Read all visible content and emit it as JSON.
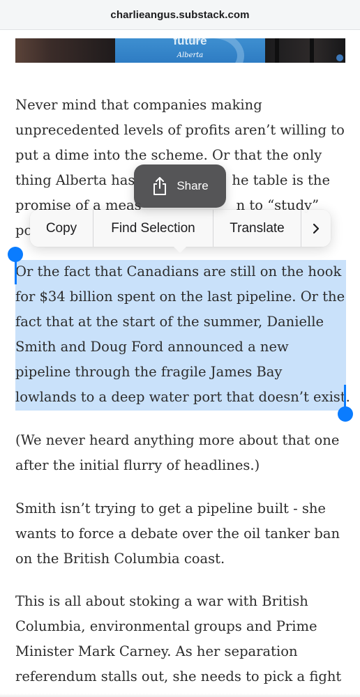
{
  "browser": {
    "url": "charlieangus.substack.com"
  },
  "hero_image": {
    "caption": "future",
    "brand": "Alberta"
  },
  "article": {
    "paragraph_1": [
      "Never mind that companies making",
      "unprecedented levels of profits aren’t willing to",
      "put a dime into the scheme. Or that the only",
      "thing Alberta has",
      "he table is the",
      "promise of a meas",
      "n to “study”",
      "pc"
    ],
    "paragraph_2": [
      "Or the fact that Canadians are still on the hook",
      "for $34 billion spent on the last pipeline. Or the",
      "fact that at the start of the summer, Danielle",
      "Smith and Doug Ford announced a new",
      "pipeline through the fragile James Bay",
      "lowlands to a deep water port that doesn’t exist."
    ],
    "paragraph_3": [
      "(We never heard anything more about that one",
      "after the initial flurry of headlines.)"
    ],
    "paragraph_4": [
      "Smith isn’t trying to get a pipeline built - she",
      "wants to force a debate over the oil tanker ban",
      "on the British Columbia coast."
    ],
    "paragraph_5": [
      "This is all about stoking a war with British",
      "Columbia, environmental groups and Prime",
      "Minister Mark Carney. As her separation",
      "referendum stalls out, she needs to pick a fight"
    ]
  },
  "share_popup": {
    "icon": "share-icon",
    "label": "Share"
  },
  "context_menu": {
    "copy": "Copy",
    "find_selection": "Find Selection",
    "translate": "Translate",
    "more_icon": "chevron-right-icon"
  },
  "colors": {
    "selection": "#94c3f5",
    "handle": "#0a7cff",
    "share_bg": "#48484a",
    "menu_bg": "#f8f8f8"
  }
}
